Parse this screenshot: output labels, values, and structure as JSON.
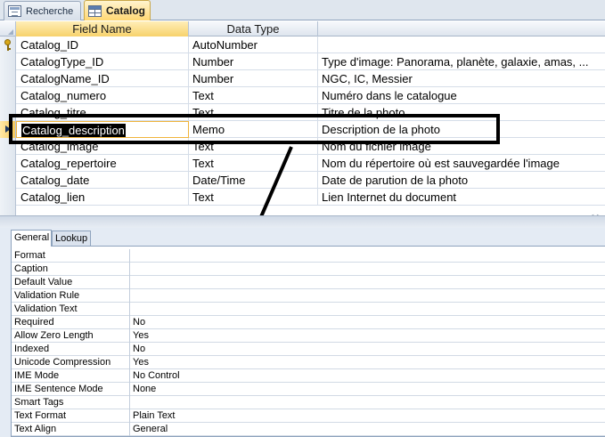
{
  "tabs": [
    {
      "label": "Recherche",
      "icon": "form-icon"
    },
    {
      "label": "Catalog",
      "icon": "table-icon"
    }
  ],
  "grid": {
    "headers": {
      "field_name": "Field Name",
      "data_type": "Data Type",
      "description": ""
    },
    "rows": [
      {
        "name": "Catalog_ID",
        "type": "AutoNumber",
        "desc": ""
      },
      {
        "name": "CatalogType_ID",
        "type": "Number",
        "desc": "Type d'image: Panorama, planète, galaxie, amas, ..."
      },
      {
        "name": "CatalogName_ID",
        "type": "Number",
        "desc": "NGC, IC, Messier"
      },
      {
        "name": "Catalog_numero",
        "type": "Text",
        "desc": "Numéro dans le catalogue"
      },
      {
        "name": "Catalog_titre",
        "type": "Text",
        "desc": "Titre de la photo"
      },
      {
        "name": "Catalog_description",
        "type": "Memo",
        "desc": "Description de la photo"
      },
      {
        "name": "Catalog_image",
        "type": "Text",
        "desc": "Nom du fichier image"
      },
      {
        "name": "Catalog_repertoire",
        "type": "Text",
        "desc": "Nom du répertoire où est sauvegardée l'image"
      },
      {
        "name": "Catalog_date",
        "type": "Date/Time",
        "desc": "Date de parution de la photo"
      },
      {
        "name": "Catalog_lien",
        "type": "Text",
        "desc": "Lien Internet du document"
      }
    ],
    "primary_key_row": 0,
    "current_row": 5
  },
  "properties": {
    "tabs": [
      "General",
      "Lookup"
    ],
    "rows": [
      {
        "label": "Format",
        "value": ""
      },
      {
        "label": "Caption",
        "value": ""
      },
      {
        "label": "Default Value",
        "value": ""
      },
      {
        "label": "Validation Rule",
        "value": ""
      },
      {
        "label": "Validation Text",
        "value": ""
      },
      {
        "label": "Required",
        "value": "No"
      },
      {
        "label": "Allow Zero Length",
        "value": "Yes"
      },
      {
        "label": "Indexed",
        "value": "No"
      },
      {
        "label": "Unicode Compression",
        "value": "Yes"
      },
      {
        "label": "IME Mode",
        "value": "No Control"
      },
      {
        "label": "IME Sentence Mode",
        "value": "None"
      },
      {
        "label": "Smart Tags",
        "value": ""
      },
      {
        "label": "Text Format",
        "value": "Plain Text"
      },
      {
        "label": "Text Align",
        "value": "General"
      }
    ]
  },
  "colors": {
    "active_tab": "#ffd773",
    "annotation": "#000000",
    "selection_bg": "#000000"
  }
}
